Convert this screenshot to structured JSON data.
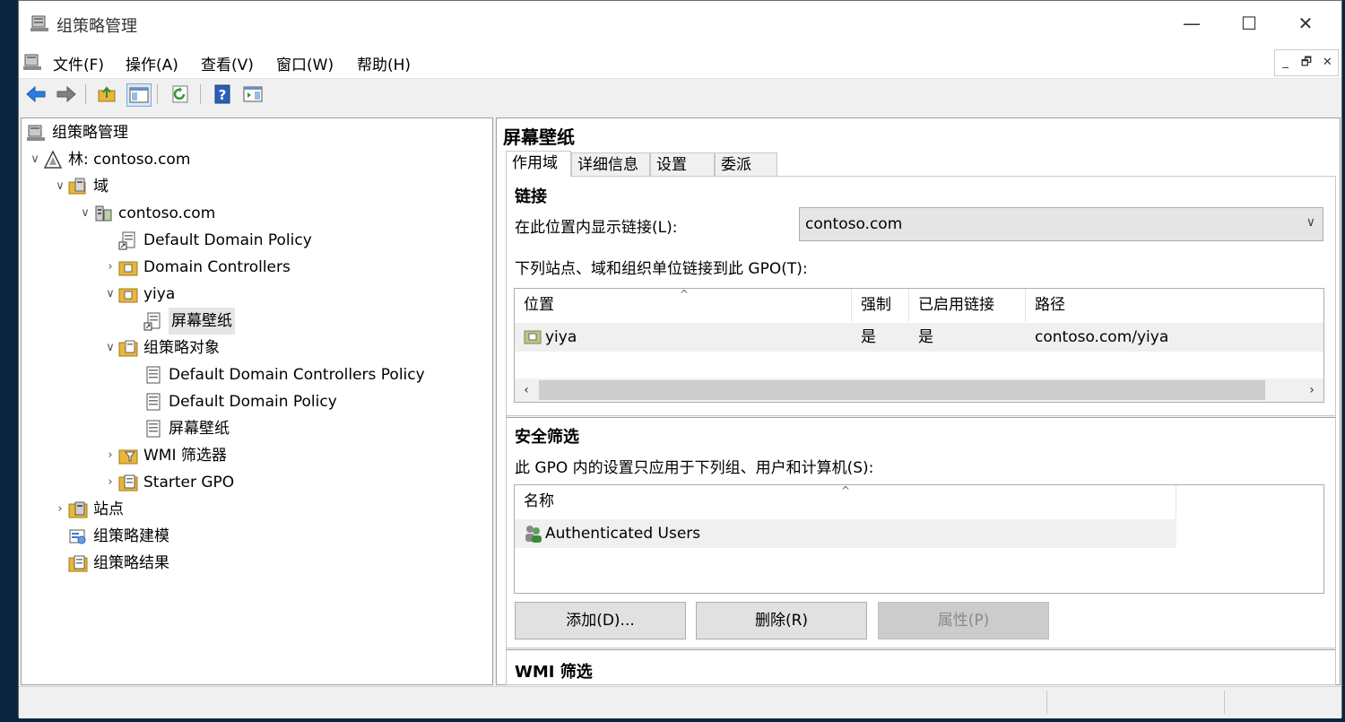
{
  "window": {
    "title": "组策略管理",
    "minimize_glyph": "—",
    "maximize_glyph": "☐",
    "close_glyph": "✕"
  },
  "menu": {
    "items": [
      "文件(F)",
      "操作(A)",
      "查看(V)",
      "窗口(W)",
      "帮助(H)"
    ],
    "mdi_min": "_",
    "mdi_restore": "🗗",
    "mdi_close": "✕"
  },
  "toolbar": {
    "icons": [
      "back-arrow-icon",
      "forward-arrow-icon",
      "up-folder-icon",
      "show-hide-tree-icon",
      "refresh-icon",
      "help-icon",
      "show-action-pane-icon"
    ]
  },
  "tree": {
    "root": "组策略管理",
    "forest": "林: contoso.com",
    "domains": "域",
    "domain": "contoso.com",
    "default_domain_policy_link": "Default Domain Policy",
    "domain_controllers": "Domain Controllers",
    "ou_yiya": "yiya",
    "wallpaper_link": "屏幕壁纸",
    "gpo_container": "组策略对象",
    "gpo_ddcp": "Default Domain Controllers Policy",
    "gpo_ddp": "Default Domain Policy",
    "gpo_wallpaper": "屏幕壁纸",
    "wmi_filters": "WMI 筛选器",
    "starter_gpo": "Starter GPO",
    "sites": "站点",
    "modeling": "组策略建模",
    "results": "组策略结果"
  },
  "details": {
    "title": "屏幕壁纸",
    "tabs": [
      "作用域",
      "详细信息",
      "设置",
      "委派"
    ],
    "active_tab": "作用域",
    "links_heading": "链接",
    "show_links_label": "在此位置内显示链接(L):",
    "location_value": "contoso.com",
    "linked_label": "下列站点、域和组织单位链接到此 GPO(T):",
    "links_table": {
      "columns": [
        "位置",
        "强制",
        "已启用链接",
        "路径"
      ],
      "rows": [
        {
          "location": "yiya",
          "enforced": "是",
          "enabled": "是",
          "path": "contoso.com/yiya"
        }
      ]
    },
    "security_heading": "安全筛选",
    "security_label": "此 GPO 内的设置只应用于下列组、用户和计算机(S):",
    "security_table": {
      "columns": [
        "名称"
      ],
      "rows": [
        {
          "name": "Authenticated Users"
        }
      ]
    },
    "buttons": {
      "add": "添加(D)...",
      "remove": "删除(R)",
      "properties": "属性(P)"
    },
    "wmi_heading": "WMI 筛选"
  }
}
